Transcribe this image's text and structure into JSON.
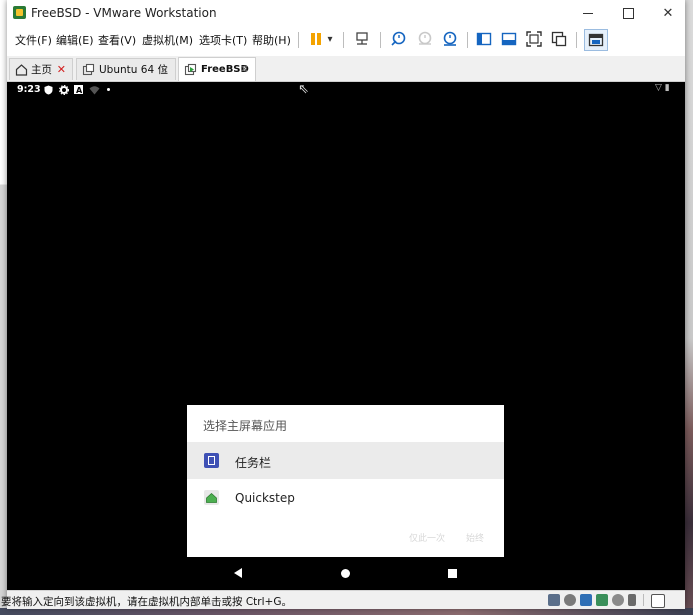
{
  "window": {
    "title": "FreeBSD - VMware Workstation",
    "controls": {
      "minimize": "—",
      "maximize": "□",
      "close": "✕"
    }
  },
  "menu": {
    "items": [
      "文件(F)",
      "编辑(E)",
      "查看(V)",
      "虚拟机(M)",
      "选项卡(T)",
      "帮助(H)"
    ],
    "pause_arrow": "▾"
  },
  "tabs": [
    {
      "label": "主页",
      "active": false,
      "close": "✕"
    },
    {
      "label": "Ubuntu 64 位",
      "active": false,
      "close": "×"
    },
    {
      "label": "FreeBSD",
      "active": true,
      "close": "×"
    }
  ],
  "android": {
    "time": "9:23",
    "status_icons": [
      "shield-icon",
      "gear-icon",
      "a-badge-icon",
      "wifi-icon",
      "dot-icon"
    ],
    "right_icons": "▽ ▮",
    "dialog": {
      "title": "选择主屏幕应用",
      "options": [
        {
          "label": "任务栏",
          "selected": true,
          "icon_color": "#3f51b5"
        },
        {
          "label": "Quickstep",
          "selected": false,
          "icon_color": "#4caf50"
        }
      ],
      "buttons": [
        "仅此一次",
        "始终"
      ]
    },
    "nav": [
      "back-icon",
      "home-icon",
      "recents-icon"
    ]
  },
  "status_bar": {
    "message": "要将输入定向到该虚拟机，请在虚拟机内部单击或按 Ctrl+G。"
  },
  "colors": {
    "accent": "#f4a300",
    "toolbar_blue": "#1565c0",
    "vm_bg": "#000000"
  }
}
